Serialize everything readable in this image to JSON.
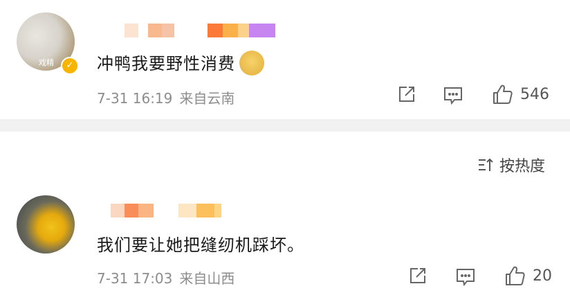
{
  "comments": [
    {
      "avatar_tag": "戏精",
      "text": "冲鸭我要野性消费",
      "time": "7-31 16:19",
      "location": "来自云南",
      "likes": "546",
      "name_blur_colors": [
        "#fde3d2",
        "#ffffff",
        "#f9b98e",
        "#f7c3a7",
        "#ffffff",
        "#fb7a3a",
        "#fbb04a",
        "#fcd28a",
        "#c785f2"
      ]
    },
    {
      "text": "我们要让她把缝纫机踩坏。",
      "time": "7-31 17:03",
      "location": "来自山西",
      "likes": "20",
      "name_blur_colors": [
        "#fad7c0",
        "#f98e5a",
        "#fbb582",
        "#ffffff",
        "#fde6c3",
        "#fbc05b",
        "#fcd482"
      ]
    }
  ],
  "sort": {
    "label": "按热度"
  },
  "colors": {
    "text": "#1a1a1a",
    "meta": "#8c8c8c",
    "divider": "#f1f1f1",
    "verified": "#f7b500"
  }
}
